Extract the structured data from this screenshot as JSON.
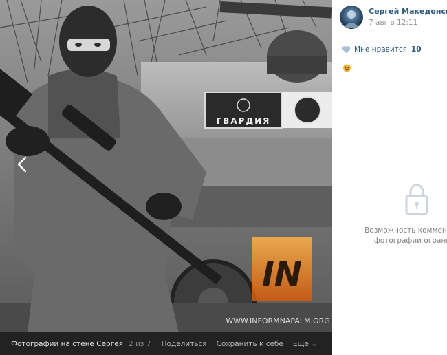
{
  "author": {
    "name": "Сергей Македонский",
    "date": "7 авг в 12:11"
  },
  "likes": {
    "label": "Мне нравится",
    "count": "10"
  },
  "comments_notice": {
    "line1": "Возможность комментиров",
    "line2": "фотографии ограничи"
  },
  "photo": {
    "patch_text": "ГВАРДИЯ",
    "watermark": "WWW.INFORMNAPALM.ORG",
    "logo_text": "IN"
  },
  "bottom_bar": {
    "album": "Фотографии на стене Сергея",
    "counter": "2 из 7",
    "share": "Поделиться",
    "save": "Сохранить к себе",
    "more": "Ещё"
  },
  "colors": {
    "link": "#2a5885",
    "muted": "#939393",
    "bar_bg": "#222222",
    "logo_orange": "#f08a1c"
  }
}
